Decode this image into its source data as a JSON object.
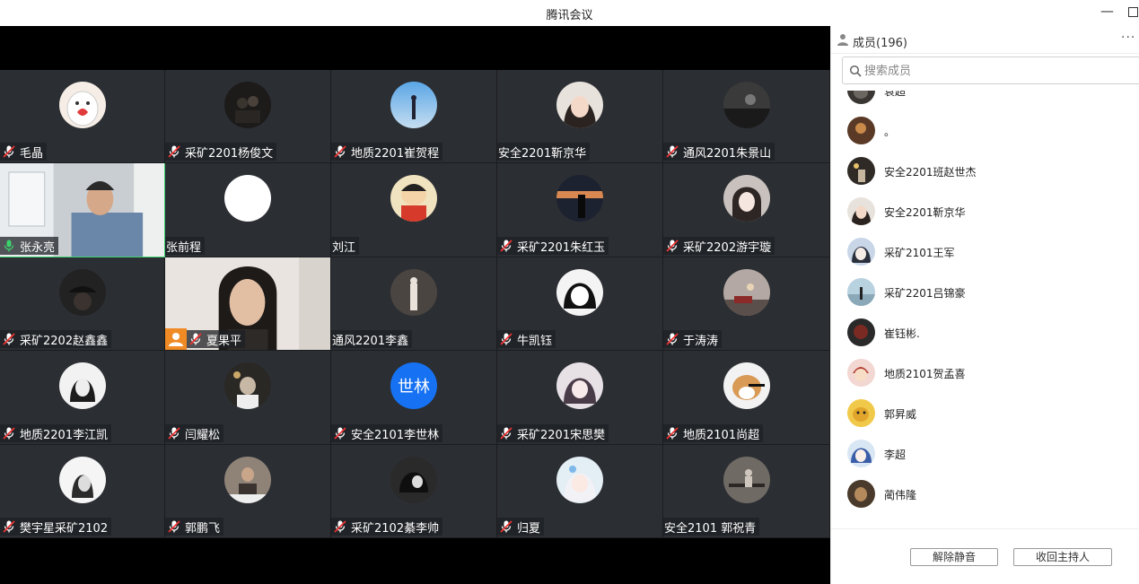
{
  "window": {
    "title": "腾讯会议"
  },
  "grid": {
    "tiles": [
      {
        "name": "毛晶",
        "muted": true,
        "avatar": "ghost-heart"
      },
      {
        "name": "采矿2201杨俊文",
        "muted": true,
        "avatar": "dark-couple"
      },
      {
        "name": "地质2201崔贺程",
        "muted": true,
        "avatar": "blue-sky-figure"
      },
      {
        "name": "安全2201靳京华",
        "muted": false,
        "avatar": "girl-face"
      },
      {
        "name": "通风2201朱景山",
        "muted": true,
        "avatar": "dark-landscape"
      },
      {
        "name": "张永亮",
        "muted": false,
        "speaking": true,
        "avatar": "camera-man"
      },
      {
        "name": "张前程",
        "muted": false,
        "avatar": "white-blank"
      },
      {
        "name": "刘江",
        "muted": false,
        "avatar": "cartoon-boy"
      },
      {
        "name": "采矿2201朱红玉",
        "muted": true,
        "avatar": "sunset-figure"
      },
      {
        "name": "采矿2202游宇璇",
        "muted": true,
        "avatar": "anime-boy"
      },
      {
        "name": "采矿2202赵鑫鑫",
        "muted": true,
        "avatar": "dark-hat"
      },
      {
        "name": "夏果平",
        "muted": true,
        "camera": true,
        "avatar": "camera-woman"
      },
      {
        "name": "通风2201李鑫",
        "muted": false,
        "avatar": "bw-figure"
      },
      {
        "name": "牛凯钰",
        "muted": true,
        "avatar": "manga-girl"
      },
      {
        "name": "于涛涛",
        "muted": true,
        "avatar": "dusk-car"
      },
      {
        "name": "地质2201李江凯",
        "muted": true,
        "avatar": "bw-girl"
      },
      {
        "name": "闫耀松",
        "muted": true,
        "avatar": "night-boy"
      },
      {
        "name": "安全2101李世林",
        "muted": true,
        "avatar": "text-avatar",
        "avatar_text": "世林"
      },
      {
        "name": "采矿2201宋思樊",
        "muted": true,
        "avatar": "anime-girl"
      },
      {
        "name": "地质2101尚超",
        "muted": true,
        "avatar": "shiba-dog"
      },
      {
        "name": "樊宇星采矿2102",
        "muted": true,
        "avatar": "bw-portrait"
      },
      {
        "name": "郭鹏飞",
        "muted": true,
        "avatar": "piano-boy"
      },
      {
        "name": "采矿2102綦李帅",
        "muted": true,
        "avatar": "dark-anime"
      },
      {
        "name": "归夏",
        "muted": true,
        "avatar": "white-hair-girl"
      },
      {
        "name": "安全2101 郭祝青",
        "muted": false,
        "avatar": "bw-bench"
      }
    ]
  },
  "panel": {
    "member_count_label": "成员(196)",
    "more_label": "···",
    "search_placeholder": "搜索成员",
    "members": [
      {
        "name": "袁超",
        "avatar": "dark-photo"
      },
      {
        "name": "。",
        "avatar": "warm-photo"
      },
      {
        "name": "安全2201班赵世杰",
        "avatar": "night-photo"
      },
      {
        "name": "安全2201靳京华",
        "avatar": "girl-face"
      },
      {
        "name": "采矿2101王军",
        "avatar": "anime-boy-blue"
      },
      {
        "name": "采矿2201吕锦豪",
        "avatar": "sky-figure"
      },
      {
        "name": "崔钰彬.",
        "avatar": "red-dark"
      },
      {
        "name": "地质2101贺孟喜",
        "avatar": "cartoon-red"
      },
      {
        "name": "郭昇威",
        "avatar": "yellow-cartoon"
      },
      {
        "name": "李超",
        "avatar": "anime-blue"
      },
      {
        "name": "蔺伟隆",
        "avatar": "brown-photo"
      }
    ],
    "footer": {
      "unmute_label": "解除静音",
      "reclaim_host_label": "收回主持人"
    }
  }
}
